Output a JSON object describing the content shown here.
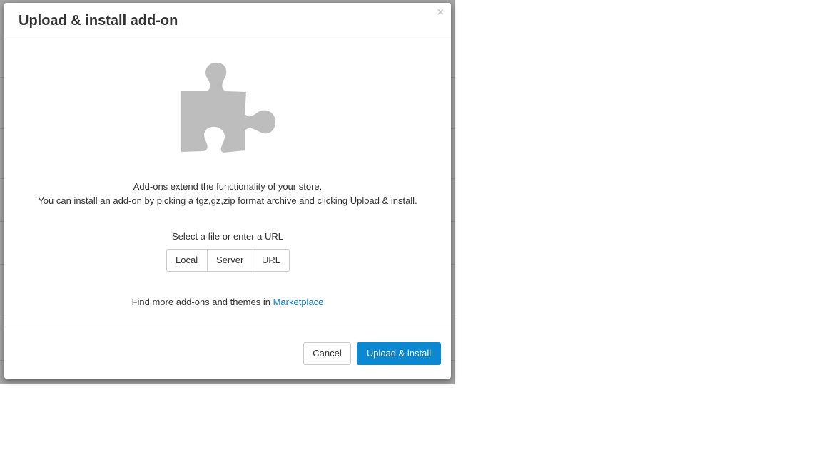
{
  "modal": {
    "title": "Upload & install add-on",
    "close_glyph": "×",
    "icon": "puzzle-piece-icon",
    "description_line1": "Add-ons extend the functionality of your store.",
    "description_line2": "You can install an add-on by picking a tgz,gz,zip format archive and clicking Upload & install.",
    "select_label": "Select a file or enter a URL",
    "source_options": {
      "local": "Local",
      "server": "Server",
      "url": "URL"
    },
    "marketplace_prefix": "Find more add-ons and themes in",
    "marketplace_link": "Marketplace",
    "cancel_label": "Cancel",
    "submit_label": "Upload & install"
  },
  "colors": {
    "primary": "#0b88d0",
    "link": "#0b7bc2",
    "icon": "#bdbdbd"
  }
}
